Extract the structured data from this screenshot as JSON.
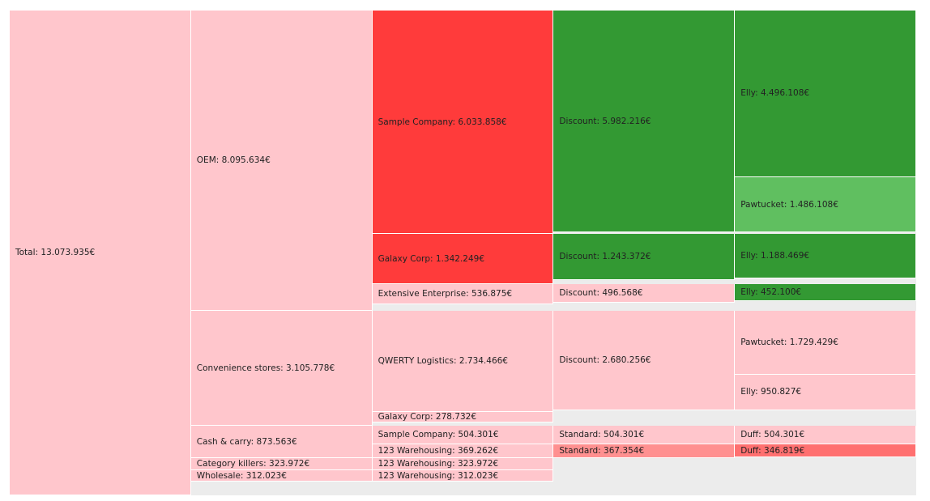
{
  "chart_data": {
    "type": "icicle",
    "colors": {
      "pink": "#ffc6cc",
      "red": "#ff3b3b",
      "green": "#339933",
      "lightgreen": "#60bf60",
      "salmon": "#ff9090",
      "coral": "#ff7070"
    },
    "tree": {
      "text": "Total: 13.073.935€",
      "value": 13073935,
      "color": "pink",
      "children": [
        {
          "text": "OEM: 8.095.634€",
          "value": 8095634,
          "color": "pink",
          "children": [
            {
              "text": "Sample Company: 6.033.858€",
              "value": 6033858,
              "color": "red",
              "children": [
                {
                  "text": "Discount: 5.982.216€",
                  "value": 5982216,
                  "color": "green",
                  "children": [
                    {
                      "text": "Elly: 4.496.108€",
                      "value": 4496108,
                      "color": "green"
                    },
                    {
                      "text": "Pawtucket: 1.486.108€",
                      "value": 1486108,
                      "color": "lightgreen"
                    }
                  ]
                }
              ]
            },
            {
              "text": "Galaxy Corp: 1.342.249€",
              "value": 1342249,
              "color": "red",
              "children": [
                {
                  "text": "Discount: 1.243.372€",
                  "value": 1243372,
                  "color": "green",
                  "children": [
                    {
                      "text": "Elly: 1.188.469€",
                      "value": 1188469,
                      "color": "green"
                    }
                  ]
                }
              ]
            },
            {
              "text": "Extensive Enterprise: 536.875€",
              "value": 536875,
              "color": "pink",
              "children": [
                {
                  "text": "Discount: 496.568€",
                  "value": 496568,
                  "color": "pink",
                  "children": [
                    {
                      "text": "Elly: 452.100€",
                      "value": 452100,
                      "color": "green"
                    }
                  ]
                }
              ]
            }
          ]
        },
        {
          "text": "Convenience stores: 3.105.778€",
          "value": 3105778,
          "color": "pink",
          "children": [
            {
              "text": "QWERTY Logistics: 2.734.466€",
              "value": 2734466,
              "color": "pink",
              "children": [
                {
                  "text": "Discount: 2.680.256€",
                  "value": 2680256,
                  "color": "pink",
                  "children": [
                    {
                      "text": "Pawtucket: 1.729.429€",
                      "value": 1729429,
                      "color": "pink"
                    },
                    {
                      "text": "Elly: 950.827€",
                      "value": 950827,
                      "color": "pink"
                    }
                  ]
                }
              ]
            },
            {
              "text": "Galaxy Corp: 278.732€",
              "value": 278732,
              "color": "pink"
            }
          ]
        },
        {
          "text": "Cash & carry: 873.563€",
          "value": 873563,
          "color": "pink",
          "children": [
            {
              "text": "Sample Company: 504.301€",
              "value": 504301,
              "color": "pink",
              "children": [
                {
                  "text": "Standard: 504.301€",
                  "value": 504301,
                  "color": "pink",
                  "children": [
                    {
                      "text": "Duff: 504.301€",
                      "value": 504301,
                      "color": "pink"
                    }
                  ]
                }
              ]
            },
            {
              "text": "123 Warehousing: 369.262€",
              "value": 369262,
              "color": "pink",
              "children": [
                {
                  "text": "Standard: 367.354€",
                  "value": 367354,
                  "color": "salmon",
                  "children": [
                    {
                      "text": "Duff: 346.819€",
                      "value": 346819,
                      "color": "coral"
                    }
                  ]
                }
              ]
            }
          ]
        },
        {
          "text": "Category killers: 323.972€",
          "value": 323972,
          "color": "pink",
          "children": [
            {
              "text": "123 Warehousing: 323.972€",
              "value": 323972,
              "color": "pink"
            }
          ]
        },
        {
          "text": "Wholesale: 312.023€",
          "value": 312023,
          "color": "pink",
          "children": [
            {
              "text": "123 Warehousing: 312.023€",
              "value": 312023,
              "color": "pink"
            }
          ]
        }
      ]
    }
  }
}
